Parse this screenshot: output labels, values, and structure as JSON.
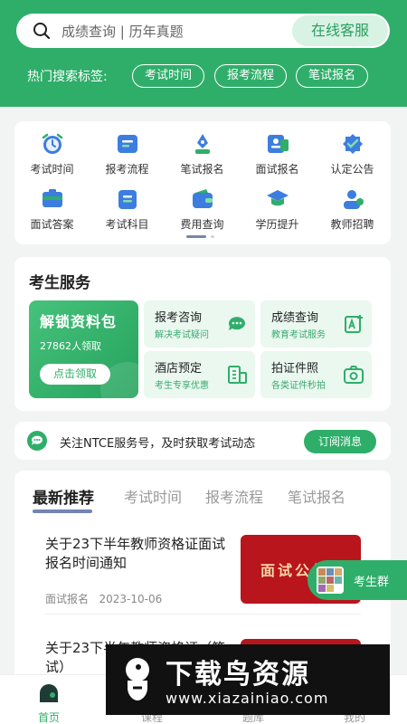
{
  "header": {
    "search_placeholder": "成绩查询 | 历年真题",
    "customer_service": "在线客服",
    "hot_label": "热门搜索标签:",
    "hot_tags": [
      "考试时间",
      "报考流程",
      "笔试报名"
    ]
  },
  "grid": {
    "items": [
      {
        "label": "考试时间",
        "icon": "alarm-clock-icon"
      },
      {
        "label": "报考流程",
        "icon": "document-flow-icon"
      },
      {
        "label": "笔试报名",
        "icon": "pen-icon"
      },
      {
        "label": "面试报名",
        "icon": "id-card-icon"
      },
      {
        "label": "认定公告",
        "icon": "verified-badge-icon"
      },
      {
        "label": "面试答案",
        "icon": "answer-sheet-icon"
      },
      {
        "label": "考试科目",
        "icon": "subject-list-icon"
      },
      {
        "label": "费用查询",
        "icon": "wallet-icon"
      },
      {
        "label": "学历提升",
        "icon": "graduation-cap-icon"
      },
      {
        "label": "教师招聘",
        "icon": "teacher-icon"
      }
    ]
  },
  "services": {
    "title": "考生服务",
    "promo": {
      "title": "解锁资料包",
      "count": "27862人领取",
      "button": "点击领取"
    },
    "tiles": [
      {
        "name": "报考咨询",
        "sub": "解决考试疑问",
        "icon": "chat-bubble-icon"
      },
      {
        "name": "成绩查询",
        "sub": "教育考试服务",
        "icon": "edit-text-icon"
      },
      {
        "name": "酒店预定",
        "sub": "考生专享优惠",
        "icon": "hotel-icon"
      },
      {
        "name": "拍证件照",
        "sub": "各类证件秒拍",
        "icon": "camera-icon"
      }
    ]
  },
  "notice": {
    "text": "关注NTCE服务号，及时获取考试动态",
    "button": "订阅消息"
  },
  "feed": {
    "tabs": [
      "最新推荐",
      "考试时间",
      "报考流程",
      "笔试报名"
    ],
    "articles": [
      {
        "title": "关于23下半年教师资格证面试报名时间通知",
        "category": "面试报名",
        "date": "2023-10-06",
        "thumb_text": "面试公告"
      },
      {
        "title": "关于23下半年教师资格证（笔试）",
        "category": "",
        "date": "",
        "thumb_text": ""
      }
    ]
  },
  "float_group": {
    "label": "考生群"
  },
  "bottom_nav": [
    {
      "label": "首页",
      "icon": "home-icon"
    },
    {
      "label": "课程",
      "icon": "course-icon"
    },
    {
      "label": "题库",
      "icon": "question-bank-icon"
    },
    {
      "label": "我的",
      "icon": "profile-icon"
    }
  ],
  "watermark": {
    "title": "下载鸟资源",
    "url": "www.xiazainiao.com"
  },
  "colors": {
    "primary": "#2fae6a",
    "light_green": "#eaf8f0",
    "thumb_red": "#b8151d"
  }
}
